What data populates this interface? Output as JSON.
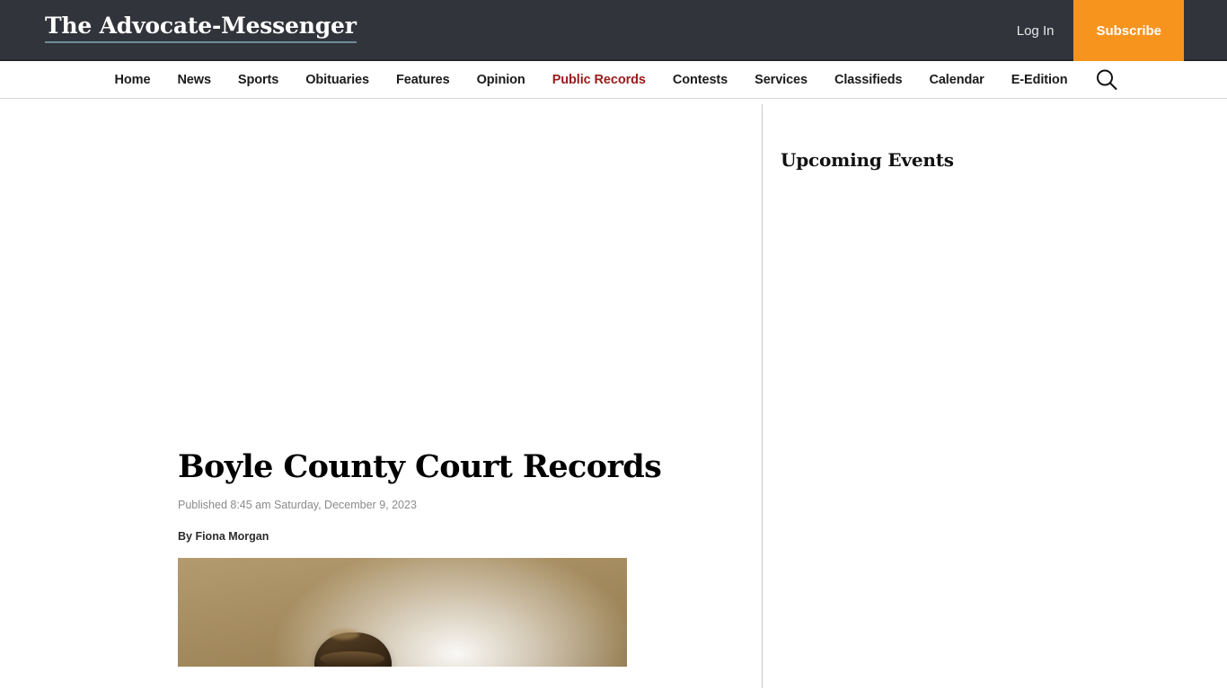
{
  "site": {
    "brand": "The Advocate-Messenger",
    "header": {
      "login_label": "Log In",
      "subscribe_label": "Subscribe",
      "background_color": "#32343b",
      "subscribe_color": "#f7941e",
      "brand_underline_color": "#6e8d95"
    },
    "nav": {
      "items": [
        {
          "label": "Home",
          "active": false
        },
        {
          "label": "News",
          "active": false
        },
        {
          "label": "Sports",
          "active": false
        },
        {
          "label": "Obituaries",
          "active": false
        },
        {
          "label": "Features",
          "active": false
        },
        {
          "label": "Opinion",
          "active": false
        },
        {
          "label": "Public Records",
          "active": true
        },
        {
          "label": "Contests",
          "active": false
        },
        {
          "label": "Services",
          "active": false
        },
        {
          "label": "Classifieds",
          "active": false
        },
        {
          "label": "Calendar",
          "active": false
        },
        {
          "label": "E-Edition",
          "active": false
        }
      ],
      "search_icon": "search-icon",
      "active_color": "#9b1b1b"
    }
  },
  "article": {
    "headline": "Boyle County Court Records",
    "published": "Published 8:45 am Saturday, December 9, 2023",
    "byline": "By Fiona Morgan",
    "feature_image_alt": "gavel"
  },
  "sidebar": {
    "title": "Upcoming Events"
  }
}
